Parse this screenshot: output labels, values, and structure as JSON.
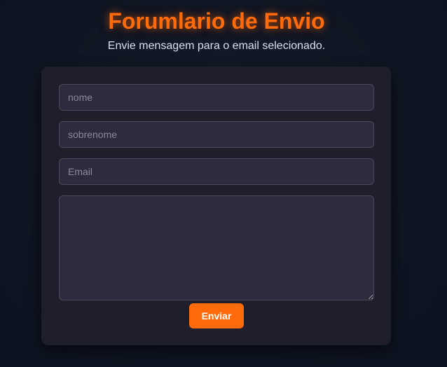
{
  "header": {
    "title": "Forumlario de Envio",
    "subtitle": "Envie mensagem para o email selecionado."
  },
  "form": {
    "nome": {
      "placeholder": "nome",
      "value": ""
    },
    "sobrenome": {
      "placeholder": "sobrenome",
      "value": ""
    },
    "email": {
      "placeholder": "Email",
      "value": ""
    },
    "message": {
      "placeholder": "",
      "value": ""
    },
    "submit_label": "Enviar"
  },
  "colors": {
    "accent": "#ff6a0a",
    "background": "#0f1522",
    "card": "#1f1f2b",
    "field": "#2c2c3e"
  }
}
